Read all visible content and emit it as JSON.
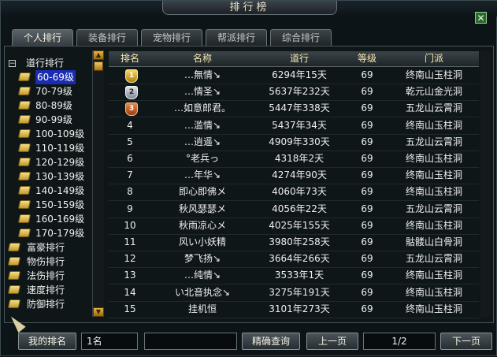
{
  "window": {
    "title": "排行榜",
    "close_symbol": "✕"
  },
  "tabs": [
    {
      "label": "个人排行",
      "active": true
    },
    {
      "label": "装备排行",
      "active": false
    },
    {
      "label": "宠物排行",
      "active": false
    },
    {
      "label": "帮派排行",
      "active": false
    },
    {
      "label": "综合排行",
      "active": false
    }
  ],
  "tree": {
    "root_label": "道行排行",
    "expander": "−",
    "sub_items": [
      "60-69级",
      "70-79级",
      "80-89级",
      "90-99级",
      "100-109级",
      "110-119级",
      "120-129级",
      "130-139级",
      "140-149级",
      "150-159级",
      "160-169级",
      "170-179级"
    ],
    "selected_index": 0,
    "other_categories": [
      "富豪排行",
      "物伤排行",
      "法伤排行",
      "速度排行",
      "防御排行"
    ]
  },
  "table": {
    "headers": [
      "排名",
      "名称",
      "道行",
      "等级",
      "门派"
    ],
    "rows": [
      {
        "rank": "1",
        "medal": "m1",
        "name": "…無情↘",
        "daoheng": "6294年15天",
        "level": "69",
        "sect": "终南山玉柱洞"
      },
      {
        "rank": "2",
        "medal": "m2",
        "name": "…情圣↘",
        "daoheng": "5637年232天",
        "level": "69",
        "sect": "乾元山金光洞"
      },
      {
        "rank": "3",
        "medal": "m3",
        "name": "…如意郎君。",
        "daoheng": "5447年338天",
        "level": "69",
        "sect": "五龙山云霄洞"
      },
      {
        "rank": "4",
        "medal": "",
        "name": "…滥情↘",
        "daoheng": "5437年34天",
        "level": "69",
        "sect": "终南山玉柱洞"
      },
      {
        "rank": "5",
        "medal": "",
        "name": "…逍遥↘",
        "daoheng": "4909年330天",
        "level": "69",
        "sect": "五龙山云霄洞"
      },
      {
        "rank": "6",
        "medal": "",
        "name": "°老兵っ",
        "daoheng": "4318年2天",
        "level": "69",
        "sect": "终南山玉柱洞"
      },
      {
        "rank": "7",
        "medal": "",
        "name": "…年华↘",
        "daoheng": "4274年90天",
        "level": "69",
        "sect": "终南山玉柱洞"
      },
      {
        "rank": "8",
        "medal": "",
        "name": "即心即佛メ",
        "daoheng": "4060年73天",
        "level": "69",
        "sect": "终南山玉柱洞"
      },
      {
        "rank": "9",
        "medal": "",
        "name": "秋风瑟瑟メ",
        "daoheng": "4056年22天",
        "level": "69",
        "sect": "五龙山云霄洞"
      },
      {
        "rank": "10",
        "medal": "",
        "name": "秋雨凉心メ",
        "daoheng": "4025年155天",
        "level": "69",
        "sect": "终南山玉柱洞"
      },
      {
        "rank": "11",
        "medal": "",
        "name": "风い小妖精",
        "daoheng": "3980年258天",
        "level": "69",
        "sect": "骷髅山白骨洞"
      },
      {
        "rank": "12",
        "medal": "",
        "name": "梦飞扬↘",
        "daoheng": "3664年266天",
        "level": "69",
        "sect": "五龙山云霄洞"
      },
      {
        "rank": "13",
        "medal": "",
        "name": "…纯情↘",
        "daoheng": "3533年1天",
        "level": "69",
        "sect": "终南山玉柱洞"
      },
      {
        "rank": "14",
        "medal": "",
        "name": "い北音执念↘",
        "daoheng": "3275年191天",
        "level": "69",
        "sect": "终南山玉柱洞"
      },
      {
        "rank": "15",
        "medal": "",
        "name": "挂机恒",
        "daoheng": "3101年273天",
        "level": "69",
        "sect": "终南山玉柱洞"
      }
    ]
  },
  "bottom": {
    "my_rank_label": "我的排名",
    "my_rank_value": "1名",
    "query_value": "",
    "query_button": "精确查询",
    "prev_button": "上一页",
    "page": "1/2",
    "next_button": "下一页"
  },
  "scroll": {
    "up": "▲",
    "down": "▼"
  }
}
